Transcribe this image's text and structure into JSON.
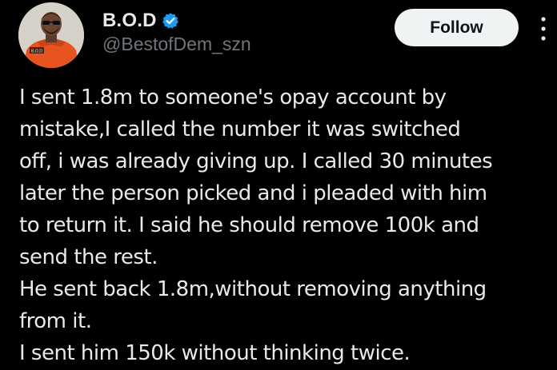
{
  "author": {
    "display_name": "B.O.D",
    "handle": "@BestofDem_szn",
    "verified_icon": "verified-badge-icon",
    "avatar_shirt_text": "B.O.D"
  },
  "actions": {
    "follow_label": "Follow",
    "more_icon": "more-options-icon"
  },
  "tweet": {
    "lines": [
      "I sent 1.8m to someone's opay account by",
      "mistake,I called the number it was switched",
      "off, i was already giving up. I called 30 minutes",
      "later the person picked and i pleaded with him",
      "to return it. I said he should  remove 100k and",
      "send the rest.",
      "He sent back 1.8m,without removing anything",
      "from it.",
      "I sent him 150k without thinking twice."
    ]
  },
  "colors": {
    "background": "#000000",
    "primary_text": "#e7e9ea",
    "secondary_text": "#71767b",
    "verified_blue": "#1d9bf0",
    "follow_button_bg": "#eff3f4",
    "follow_button_text": "#0f1419",
    "avatar_shirt": "#e8541f"
  }
}
